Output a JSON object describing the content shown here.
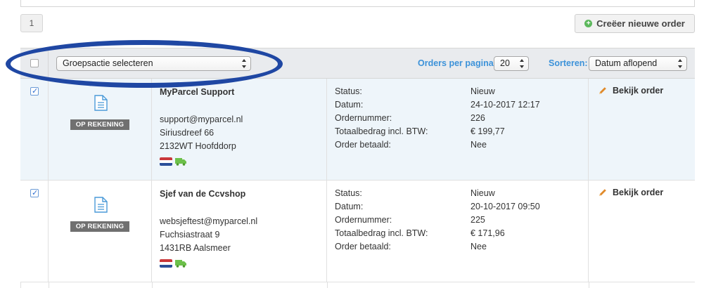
{
  "pagination": {
    "current_page": "1"
  },
  "actions": {
    "new_order_label": "Creëer nieuwe order"
  },
  "toolbar": {
    "group_action_value": "Groepsactie selecteren",
    "orders_per_page_label": "Orders per pagina",
    "orders_per_page_value": "20",
    "sort_label": "Sorteren:",
    "sort_value": "Datum aflopend"
  },
  "detail_labels": {
    "status": "Status:",
    "date": "Datum:",
    "order_number": "Ordernummer:",
    "total": "Totaalbedrag incl. BTW:",
    "paid": "Order betaald:"
  },
  "view_order_label": "Bekijk order",
  "orders": [
    {
      "checked": true,
      "payment_badge": "OP REKENING",
      "customer_name": "MyParcel Support",
      "email": "support@myparcel.nl",
      "street": "Siriusdreef 66",
      "postal_city": "2132WT Hoofddorp",
      "status": "Nieuw",
      "date": "24-10-2017 12:17",
      "order_number": "226",
      "total": "€ 199,77",
      "paid": "Nee"
    },
    {
      "checked": true,
      "payment_badge": "OP REKENING",
      "customer_name": "Sjef van de Ccvshop",
      "email": "websjeftest@myparcel.nl",
      "street": "Fuchsiastraat 9",
      "postal_city": "1431RB Aalsmeer",
      "status": "Nieuw",
      "date": "20-10-2017 09:50",
      "order_number": "225",
      "total": "€ 171,96",
      "paid": "Nee"
    }
  ],
  "colors": {
    "accent_blue": "#3c92d9",
    "annotation_ellipse": "#1f47a3",
    "badge_gray": "#707070",
    "highlight_row": "#eef5fa"
  }
}
